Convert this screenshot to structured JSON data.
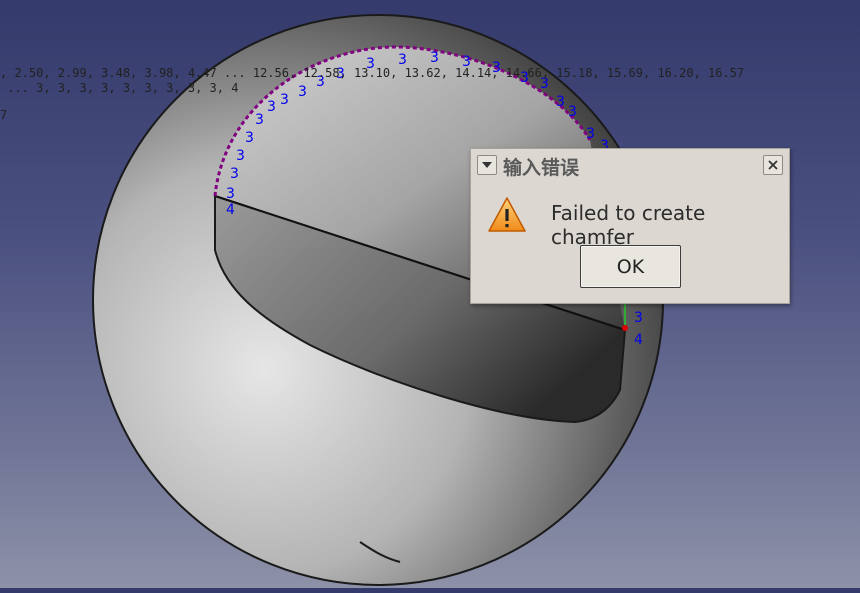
{
  "viewport": {
    "overlay_line1": ", 2.50, 2.99, 3.48, 3.98, 4.47 ... 12.56, 12.58, 13.10, 13.62, 14.14, 14.66, 15.18, 15.69, 16.20, 16.57",
    "overlay_line2": " ... 3, 3, 3, 3, 3, 3, 3, 3, 3, 4",
    "overlay_line3": "7",
    "vertex_labels": [
      "4",
      "3",
      "3",
      "3",
      "3",
      "3",
      "3",
      "3",
      "3",
      "3",
      "3",
      "3",
      "3",
      "3",
      "3",
      "3",
      "3",
      "3",
      "3",
      "3",
      "3",
      "3",
      "3",
      "3",
      "4"
    ],
    "colors": {
      "label": "#0000ee",
      "edge": "#800080",
      "outline": "#1a1a1a"
    }
  },
  "dialog": {
    "title": "输入错误",
    "message": "Failed to create chamfer",
    "ok_label": "OK",
    "icons": {
      "menu": "chevron-down-icon",
      "close": "close-icon",
      "status": "warning-icon"
    }
  }
}
